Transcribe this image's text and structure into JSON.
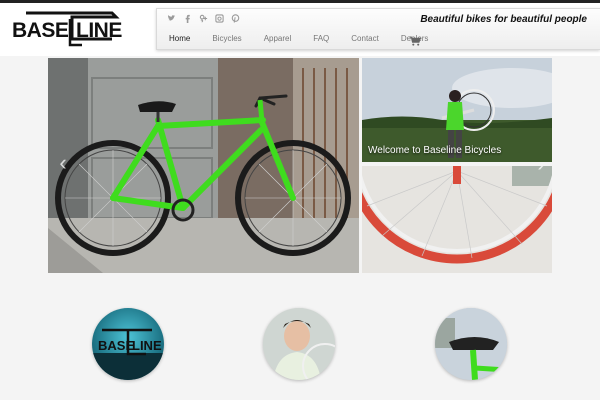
{
  "header": {
    "logo_text_left": "BASE",
    "logo_text_right": "LINE",
    "tagline": "Beautiful bikes for beautiful people",
    "social_icons": [
      "twitter-icon",
      "facebook-icon",
      "google-plus-icon",
      "instagram-icon",
      "pinterest-icon"
    ],
    "nav": [
      {
        "label": "Home",
        "active": true
      },
      {
        "label": "Bicycles",
        "active": false
      },
      {
        "label": "Apparel",
        "active": false
      },
      {
        "label": "FAQ",
        "active": false
      },
      {
        "label": "Contact",
        "active": false
      },
      {
        "label": "Dealers",
        "active": false
      }
    ],
    "cart_icon": "cart-icon"
  },
  "gallery": {
    "caption": "Welcome to Baseline Bicycles",
    "prev_icon": "chevron-left-icon",
    "next_icon": "chevron-right-icon"
  },
  "features": {
    "circle_logo_left": "BASE",
    "circle_logo_right": "LINE"
  },
  "colors": {
    "accent_green": "#3fdc1e",
    "rim_red": "#d94a3a"
  }
}
